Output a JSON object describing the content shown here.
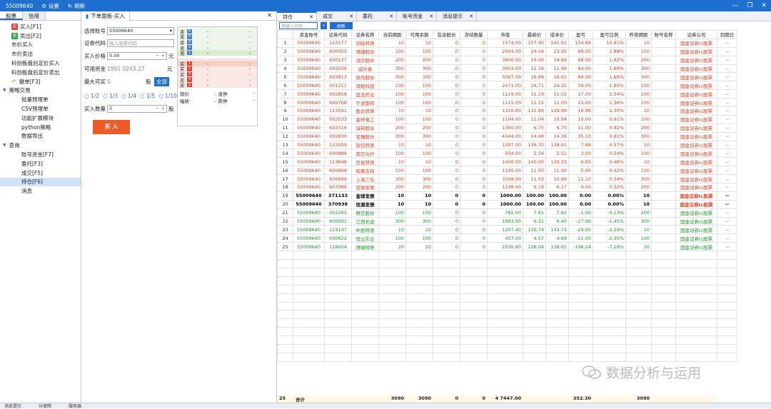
{
  "titlebar": {
    "account": "55009640",
    "settings": "设置",
    "refresh": "刷新"
  },
  "left": {
    "tabs": [
      "股票",
      "信用"
    ],
    "items": [
      {
        "label": "买入[F1]",
        "badge": "买",
        "type": "buy"
      },
      {
        "label": "卖出[F2]",
        "badge": "卖",
        "type": "sell"
      },
      {
        "label": "市价买入",
        "type": "plain"
      },
      {
        "label": "市价卖出",
        "type": "plain"
      },
      {
        "label": "科创板盘后定价买入",
        "type": "plain"
      },
      {
        "label": "科创板盘后定价卖出",
        "type": "plain"
      },
      {
        "label": "撤单[F3]",
        "type": "undo"
      },
      {
        "label": "策略交易",
        "type": "group"
      },
      {
        "label": "批量预埋单",
        "type": "sub"
      },
      {
        "label": "CSV预埋单",
        "type": "sub"
      },
      {
        "label": "功能扩展模块",
        "type": "sub"
      },
      {
        "label": "python策略",
        "type": "sub"
      },
      {
        "label": "数据导出",
        "type": "sub"
      },
      {
        "label": "查询",
        "type": "group"
      },
      {
        "label": "账号资金[F7]",
        "type": "sub"
      },
      {
        "label": "委托[F3]",
        "type": "sub"
      },
      {
        "label": "成交[F5]",
        "type": "sub"
      },
      {
        "label": "持仓[F6]",
        "type": "sub",
        "selected": true
      },
      {
        "label": "消息",
        "type": "sub"
      }
    ]
  },
  "order": {
    "tab": "下单面板-买入",
    "account_label": "选择账号",
    "account_value": "55009640",
    "code_label": "证券代码",
    "code_placeholder": "输入股票代码",
    "price_label": "买入价格",
    "price_value": "0.00",
    "price_unit": "元",
    "funds_label": "可用资金",
    "funds_value": "1991 0243.27",
    "funds_unit": "元",
    "max_label": "最大可买",
    "max_value": "0",
    "max_unit": "股",
    "all_btn": "全部",
    "fractions": [
      "1/2",
      "1/3",
      "1/4",
      "1/5",
      "1/10"
    ],
    "qty_label": "买入数量",
    "qty_value": "0",
    "qty_unit": "股",
    "buy_btn": "买 入",
    "quote": {
      "sells": [
        {
          "l": "卖",
          "n": "5"
        },
        {
          "l": "卖",
          "n": "4"
        },
        {
          "l": "卖",
          "n": "3"
        },
        {
          "l": "卖",
          "n": "2"
        },
        {
          "l": "卖",
          "n": "1"
        }
      ],
      "buys": [
        {
          "l": "买",
          "n": "1"
        },
        {
          "l": "买",
          "n": "2"
        },
        {
          "l": "买",
          "n": "3"
        },
        {
          "l": "买",
          "n": "4"
        },
        {
          "l": "买",
          "n": "5"
        }
      ],
      "dash": "-",
      "now_label": "现价",
      "limit_up": "涨停",
      "chg_label": "幅收",
      "limit_down": "跌停"
    }
  },
  "main": {
    "tabs": [
      "持仓",
      "成交",
      "委托",
      "账号资金",
      "消息提示"
    ],
    "search_placeholder": "请输入代码",
    "refresh": "刷新",
    "columns": [
      "",
      "资金账号",
      "证券代码",
      "证券名称",
      "当前拥股",
      "可用余额",
      "在途股份",
      "冻结数量",
      "市值",
      "最新价",
      "成本价",
      "盈亏",
      "盈亏比例",
      "昨夜拥股",
      "账号名称",
      "证券公司",
      "到期日"
    ],
    "rows": [
      {
        "c": "red",
        "v": [
          "1",
          "55009640",
          "123177",
          "测绘转债",
          "10",
          "10",
          "0",
          "0",
          "1574.00",
          "157.40",
          "141.91",
          "154.88",
          "10.91%",
          "10",
          "",
          "国金证券tc股票",
          "--"
        ]
      },
      {
        "c": "red",
        "v": [
          "2",
          "55009640",
          "600455",
          "博通股份",
          "100",
          "100",
          "0",
          "0",
          "2404.00",
          "24.04",
          "23.95",
          "69.00",
          "2.88%",
          "100",
          "",
          "国金证券tc股票",
          "--"
        ]
      },
      {
        "c": "red",
        "v": [
          "3",
          "55009640",
          "600137",
          "浪莎股份",
          "200",
          "200",
          "0",
          "0",
          "3800.00",
          "19.00",
          "18.66",
          "68.00",
          "1.82%",
          "200",
          "",
          "国金证券tc股票",
          "--"
        ]
      },
      {
        "c": "red",
        "v": [
          "4",
          "55009640",
          "002058",
          "威尔泰",
          "300",
          "300",
          "0",
          "0",
          "3654.00",
          "12.18",
          "11.98",
          "60.00",
          "1.69%",
          "300",
          "",
          "国金证券tc股票",
          "--"
        ]
      },
      {
        "c": "red",
        "v": [
          "5",
          "55009640",
          "603813",
          "原尚股份",
          "300",
          "300",
          "0",
          "0",
          "5067.00",
          "16.89",
          "16.61",
          "84.00",
          "1.69%",
          "300",
          "",
          "国金证券tc股票",
          "--"
        ]
      },
      {
        "c": "red",
        "v": [
          "6",
          "55009640",
          "001211",
          "双枪科技",
          "100",
          "100",
          "0",
          "0",
          "2471.00",
          "24.71",
          "24.32",
          "39.00",
          "1.60%",
          "100",
          "",
          "国金证券tc股票",
          "--"
        ]
      },
      {
        "c": "red",
        "v": [
          "7",
          "55009640",
          "002858",
          "盘龙药业",
          "100",
          "100",
          "0",
          "0",
          "1119.00",
          "11.19",
          "11.02",
          "17.00",
          "1.54%",
          "100",
          "",
          "国金证券tc股票",
          "--"
        ]
      },
      {
        "c": "red",
        "v": [
          "8",
          "55009640",
          "600768",
          "宁波富邦",
          "100",
          "100",
          "0",
          "0",
          "1115.00",
          "11.15",
          "11.00",
          "15.00",
          "1.36%",
          "100",
          "",
          "国金证券tc股票",
          "--"
        ]
      },
      {
        "c": "red",
        "v": [
          "9",
          "55009640",
          "113591",
          "胜达转债",
          "10",
          "10",
          "0",
          "0",
          "1316.80",
          "131.68",
          "129.99",
          "16.88",
          "1.30%",
          "10",
          "",
          "国金证券tc股票",
          "--"
        ]
      },
      {
        "c": "red",
        "v": [
          "10",
          "55009640",
          "002533",
          "金杯电工",
          "100",
          "100",
          "0",
          "0",
          "1104.00",
          "11.04",
          "10.94",
          "10.00",
          "0.91%",
          "100",
          "",
          "国金证券tc股票",
          "--"
        ]
      },
      {
        "c": "red",
        "v": [
          "11",
          "55009640",
          "603316",
          "诚邦股份",
          "200",
          "200",
          "0",
          "0",
          "1350.00",
          "6.75",
          "6.70",
          "11.00",
          "0.82%",
          "200",
          "",
          "国金证券tc股票",
          "--"
        ]
      },
      {
        "c": "red",
        "v": [
          "12",
          "55009640",
          "002830",
          "名雕股份",
          "300",
          "300",
          "0",
          "0",
          "4344.00",
          "14.48",
          "14.36",
          "35.10",
          "0.81%",
          "300",
          "",
          "国金证券tc股票",
          "--"
        ]
      },
      {
        "c": "red",
        "v": [
          "13",
          "55009640",
          "123059",
          "银信转债",
          "10",
          "10",
          "0",
          "0",
          "1397.00",
          "139.70",
          "138.91",
          "7.88",
          "0.57%",
          "10",
          "",
          "国金证券tc股票",
          "--"
        ]
      },
      {
        "c": "red",
        "v": [
          "14",
          "55009640",
          "600889",
          "南京化纤",
          "100",
          "100",
          "0",
          "0",
          "554.00",
          "5.54",
          "5.51",
          "3.00",
          "0.54%",
          "100",
          "",
          "国金证券tc股票",
          "--"
        ]
      },
      {
        "c": "red",
        "v": [
          "15",
          "55009640",
          "113648",
          "巨星转债",
          "10",
          "10",
          "0",
          "0",
          "1400.00",
          "140.00",
          "139.33",
          "6.65",
          "0.48%",
          "10",
          "",
          "国金证券tc股票",
          "--"
        ]
      },
      {
        "c": "red",
        "v": [
          "16",
          "55009640",
          "600868",
          "梅雁吉祥",
          "100",
          "100",
          "0",
          "0",
          "1195.00",
          "11.95",
          "11.90",
          "5.00",
          "0.42%",
          "100",
          "",
          "国金证券tc股票",
          "--"
        ]
      },
      {
        "c": "red",
        "v": [
          "17",
          "55009640",
          "600689",
          "上海三毛",
          "300",
          "300",
          "0",
          "0",
          "3309.00",
          "11.03",
          "10.99",
          "11.10",
          "0.34%",
          "300",
          "",
          "国金证券tc股票",
          "--"
        ]
      },
      {
        "c": "red",
        "v": [
          "18",
          "55009640",
          "603389",
          "亚振家居",
          "200",
          "200",
          "0",
          "0",
          "1238.00",
          "6.19",
          "6.17",
          "4.00",
          "0.32%",
          "200",
          "",
          "国金证券tc股票",
          "--"
        ]
      },
      {
        "c": "black",
        "v": [
          "19",
          "55009640",
          "371133",
          "金球发债",
          "10",
          "10",
          "0",
          "0",
          "1000.00",
          "100.00",
          "100.00",
          "0.00",
          "0.00%",
          "10",
          "",
          "国金证券tc股票",
          "--"
        ]
      },
      {
        "c": "black",
        "v": [
          "20",
          "55009640",
          "370938",
          "信测发债",
          "10",
          "10",
          "0",
          "0",
          "1000.00",
          "100.00",
          "100.00",
          "0.00",
          "0.00%",
          "10",
          "",
          "国金证券tc股票",
          "--"
        ]
      },
      {
        "c": "green",
        "v": [
          "21",
          "55009640",
          "002295",
          "精艺股份",
          "100",
          "100",
          "0",
          "0",
          "781.00",
          "7.81",
          "7.82",
          "-1.00",
          "-0.13%",
          "100",
          "",
          "国金证券tc股票",
          "--"
        ]
      },
      {
        "c": "green",
        "v": [
          "22",
          "55009640",
          "600561",
          "江西长运",
          "300",
          "300",
          "0",
          "0",
          "1893.00",
          "6.31",
          "6.40",
          "-27.90",
          "-1.45%",
          "300",
          "",
          "国金证券tc股票",
          "--"
        ]
      },
      {
        "c": "green",
        "v": [
          "23",
          "55009640",
          "123147",
          "中辰转债",
          "10",
          "10",
          "0",
          "0",
          "1307.40",
          "130.74",
          "133.73",
          "-29.95",
          "-2.24%",
          "10",
          "",
          "国金证券tc股票",
          "--"
        ]
      },
      {
        "c": "green",
        "v": [
          "24",
          "55009640",
          "000622",
          "恒立实业",
          "100",
          "100",
          "0",
          "0",
          "457.00",
          "4.57",
          "4.68",
          "-11.00",
          "-2.35%",
          "100",
          "",
          "国金证券tc股票",
          "--"
        ]
      },
      {
        "c": "green",
        "v": [
          "25",
          "55009640",
          "118004",
          "博瑞转债",
          "20",
          "20",
          "0",
          "0",
          "2530.80",
          "126.04",
          "138.65",
          "-196.24",
          "-7.18%",
          "20",
          "",
          "国金证券tc股票",
          "--"
        ]
      }
    ],
    "total": {
      "idx": "25",
      "label": "合计",
      "hold": "3090",
      "avail": "3090",
      "transit": "0",
      "frozen": "0",
      "value": "4 7447.00",
      "pnl": "352.30",
      "yesterday": "3090"
    }
  },
  "watermark": "数据分析与运用",
  "status": [
    "消息提示",
    "分保障",
    "服务器"
  ],
  "colors": {
    "accent": "#1e6fd0",
    "up": "#e04020",
    "down": "#1a9a2a",
    "buy": "#f05a24"
  }
}
